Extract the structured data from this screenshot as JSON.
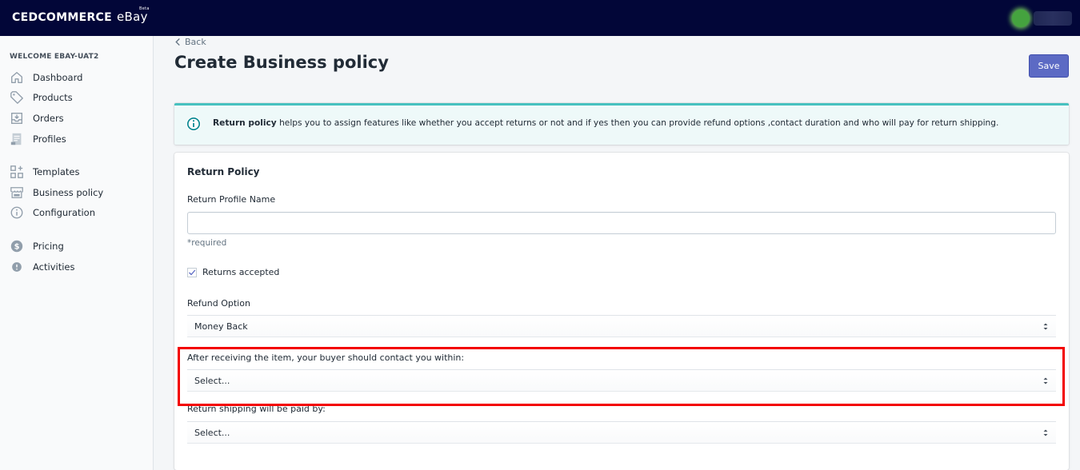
{
  "app": {
    "brand": "CEDCOMMERCE",
    "brand_sub": "eBay",
    "brand_badge": "Beta"
  },
  "sidebar": {
    "welcome": "WELCOME EBAY-UAT2",
    "items": [
      {
        "label": "Dashboard",
        "icon": "home-icon"
      },
      {
        "label": "Products",
        "icon": "tag-icon"
      },
      {
        "label": "Orders",
        "icon": "inbox-icon"
      },
      {
        "label": "Profiles",
        "icon": "document-icon"
      },
      {
        "label": "Templates",
        "icon": "apps-icon"
      },
      {
        "label": "Business policy",
        "icon": "store-icon"
      },
      {
        "label": "Configuration",
        "icon": "info-icon"
      },
      {
        "label": "Pricing",
        "icon": "dollar-icon"
      },
      {
        "label": "Activities",
        "icon": "alert-icon"
      }
    ]
  },
  "header": {
    "back_label": "Back",
    "title": "Create Business policy",
    "save_label": "Save"
  },
  "banner": {
    "bold": "Return policy",
    "text": " helps you to assign features like whether you accept returns or not and if yes then you can provide refund options ,contact duration and who will pay for return shipping.",
    "accent_color": "#47c1bf"
  },
  "form": {
    "section_title": "Return Policy",
    "profile_name_label": "Return Profile Name",
    "profile_name_value": "",
    "required_hint": "*required",
    "returns_accepted_label": "Returns accepted",
    "returns_accepted_checked": true,
    "refund_option_label": "Refund Option",
    "refund_option_value": "Money Back",
    "contact_within_label": "After receiving the item, your buyer should contact you within:",
    "contact_within_value": "Select...",
    "shipping_paid_by_label": "Return shipping will be paid by:",
    "shipping_paid_by_value": "Select..."
  },
  "colors": {
    "topbar": "#020638",
    "primary_button": "#5c6ac4",
    "highlight_box": "#f30000"
  }
}
